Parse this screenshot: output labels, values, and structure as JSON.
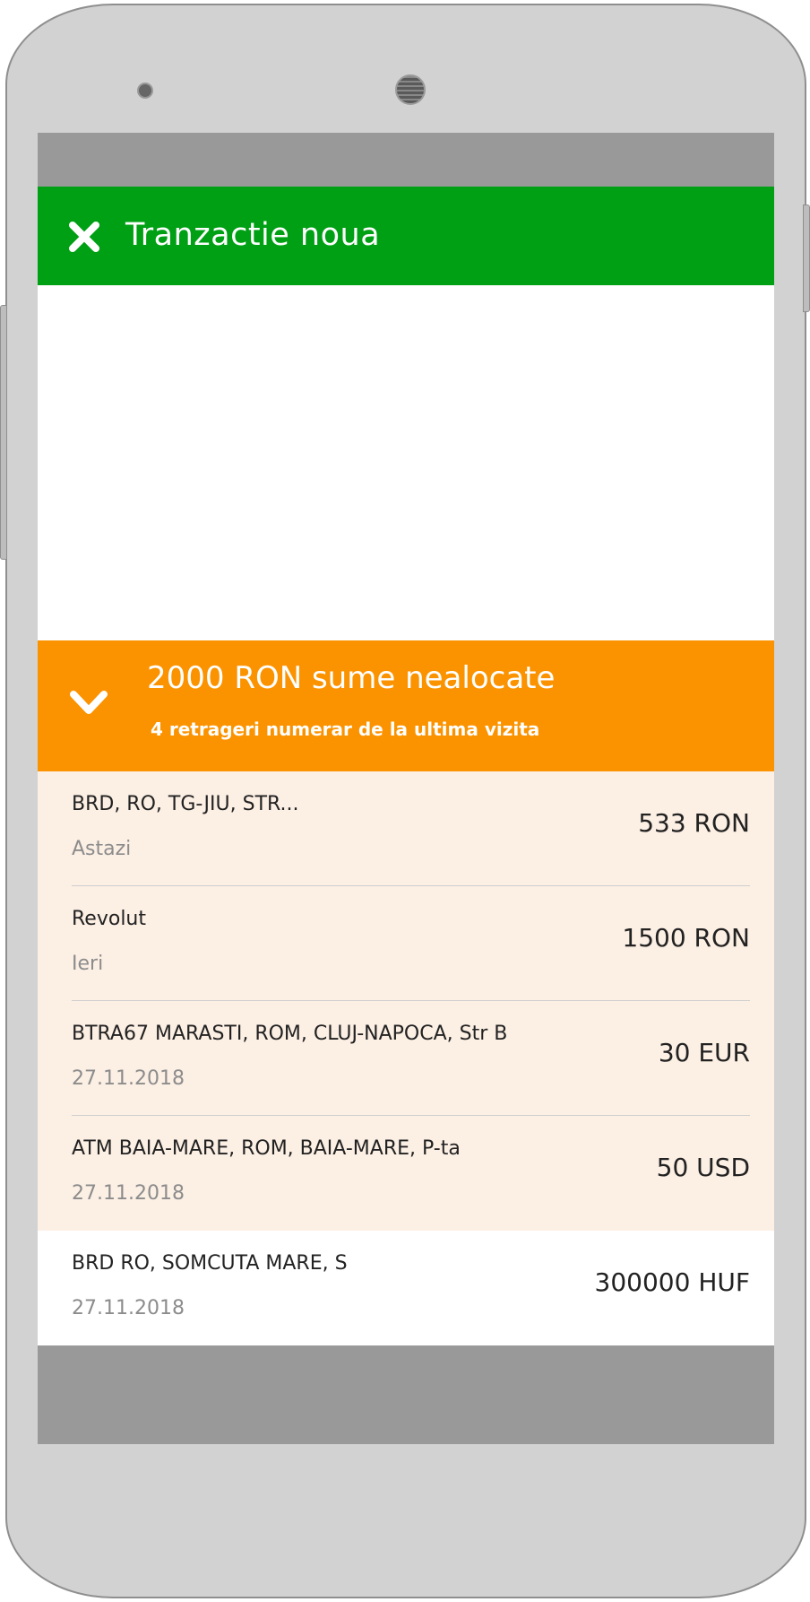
{
  "app_bar": {
    "title": "Tranzactie noua",
    "close_icon": "close-icon",
    "color": "#00a014"
  },
  "summary": {
    "title": "2000 RON sume nealocate",
    "subtitle": "4 retrageri numerar de la ultima vizita",
    "expand_icon": "chevron-down-icon",
    "color": "#fb9300"
  },
  "transactions": [
    {
      "title": "BRD, RO, TG-JIU, STR...",
      "date": "Astazi",
      "amount": "533 RON",
      "highlighted": true
    },
    {
      "title": "Revolut",
      "date": "Ieri",
      "amount": "1500 RON",
      "highlighted": true
    },
    {
      "title": "BTRA67 MARASTI, ROM, CLUJ-NAPOCA, Str B",
      "date": "27.11.2018",
      "amount": "30 EUR",
      "highlighted": true
    },
    {
      "title": "ATM BAIA-MARE, ROM, BAIA-MARE, P-ta",
      "date": "27.11.2018",
      "amount": "50 USD",
      "highlighted": true
    },
    {
      "title": "BRD RO, SOMCUTA MARE, S",
      "date": "27.11.2018",
      "amount": "300000 HUF",
      "highlighted": false
    }
  ]
}
